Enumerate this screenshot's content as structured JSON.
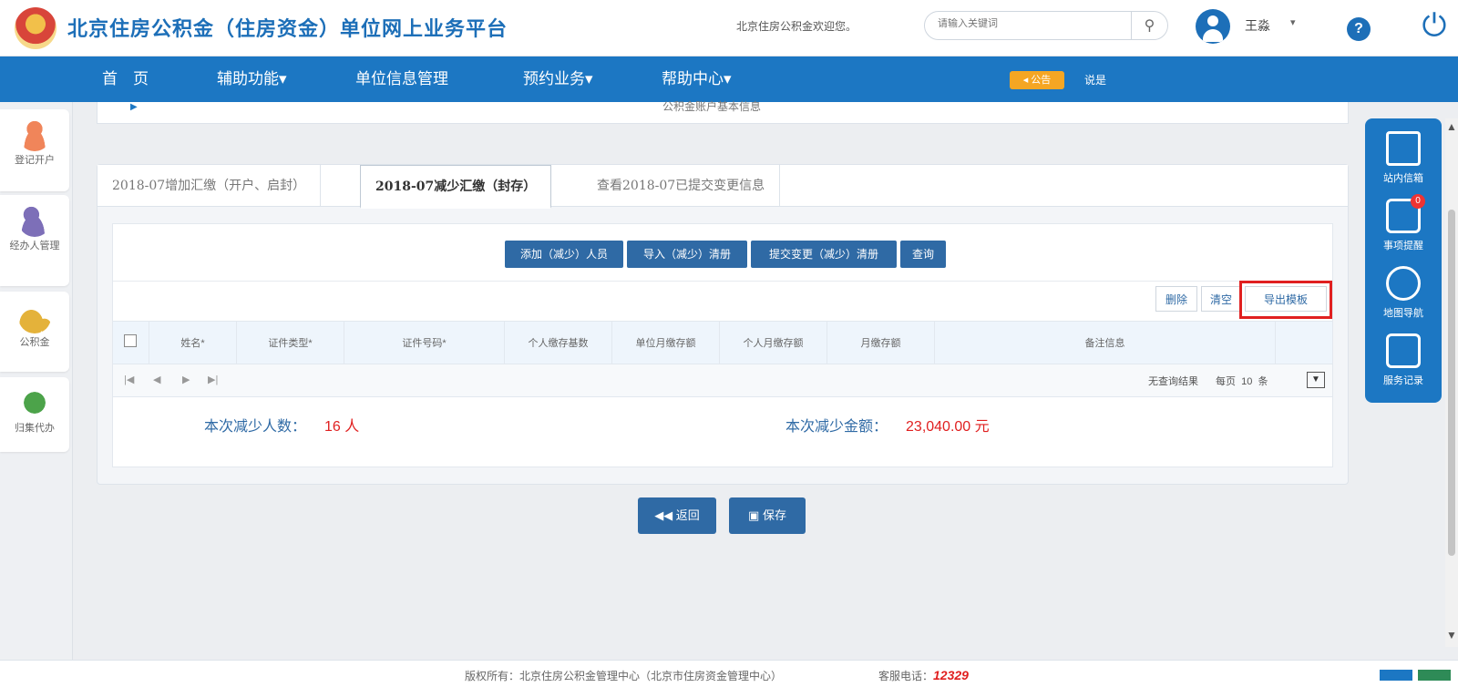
{
  "header": {
    "title": "北京住房公积金（住房资金）单位网上业务平台",
    "welcome": "北京住房公积金欢迎您。",
    "search_placeholder": "请输入关键词",
    "user_name": "王淼"
  },
  "nav": {
    "items": [
      "首　页",
      "辅助功能▾",
      "单位信息管理",
      "预约业务▾",
      "帮助中心▾"
    ],
    "notice_badge": "公告",
    "notice_text": "说是"
  },
  "sidebar": {
    "items": [
      "登记开户",
      "经办人管理",
      "公积金",
      "归集代办"
    ]
  },
  "right_panel": {
    "items": [
      "站内信箱",
      "事项提醒",
      "地图导航",
      "服务记录"
    ],
    "badge": "0"
  },
  "collapsed_panel": "公积金账户基本信息",
  "tabs": [
    "2018-07增加汇缴（开户、启封）",
    "2018-07减少汇缴（封存）",
    "查看2018-07已提交变更信息"
  ],
  "toolbar": {
    "buttons": [
      "添加（减少）人员",
      "导入（减少）清册",
      "提交变更（减少）清册",
      "查询"
    ],
    "delete": "删除",
    "clear": "清空",
    "export_template": "导出模板"
  },
  "table": {
    "columns": [
      "姓名*",
      "证件类型*",
      "证件号码*",
      "个人缴存基数",
      "单位月缴存额",
      "个人月缴存额",
      "月缴存额",
      "备注信息"
    ],
    "pager_nav": [
      "|◀",
      "◀",
      "▶",
      "▶|"
    ],
    "no_results": "无查询结果",
    "per_page_label": "每页",
    "per_page_value": "10",
    "per_page_unit": "条"
  },
  "summary": {
    "count_label": "本次减少人数：",
    "count_value": "16 人",
    "amount_label": "本次减少金额：",
    "amount_value": "23,040.00 元"
  },
  "actions": {
    "back": "返回",
    "save": "保存"
  },
  "footer": {
    "copyright": "版权所有：北京住房公积金管理中心（北京市住房资金管理中心）",
    "hotline_label": "客服电话：",
    "hotline": "12329"
  }
}
